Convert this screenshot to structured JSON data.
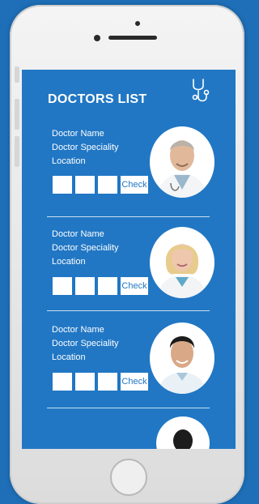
{
  "header": {
    "title": "DOCTORS LIST"
  },
  "doctors": [
    {
      "name": "Doctor Name",
      "speciality": "Doctor Speciality",
      "location": "Location",
      "check_label": "Check"
    },
    {
      "name": "Doctor Name",
      "speciality": "Doctor Speciality",
      "location": "Location",
      "check_label": "Check"
    },
    {
      "name": "Doctor Name",
      "speciality": "Doctor Speciality",
      "location": "Location",
      "check_label": "Check"
    }
  ],
  "icons": {
    "header_icon": "stethoscope-icon"
  },
  "colors": {
    "background": "#1e6fb8",
    "screen": "#2177c4",
    "text": "#ffffff"
  }
}
